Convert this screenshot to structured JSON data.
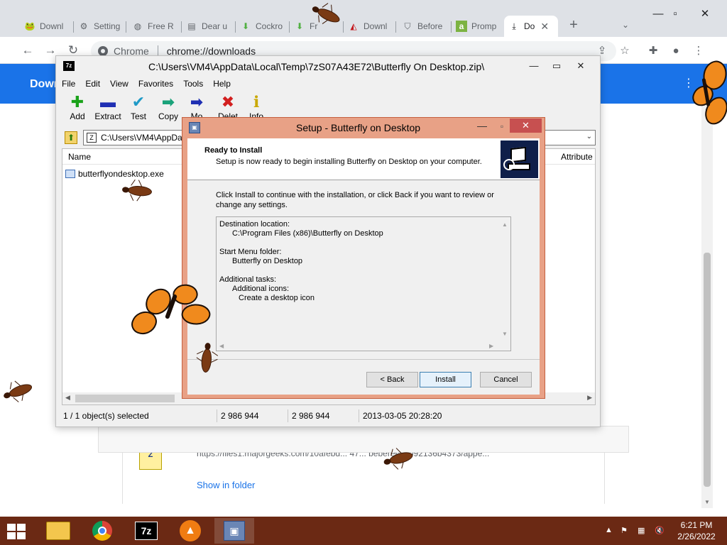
{
  "browser": {
    "tabs": [
      {
        "label": "Downl",
        "icon": "frog-icon"
      },
      {
        "label": "Setting",
        "icon": "gear-icon"
      },
      {
        "label": "Free R",
        "icon": "globe-icon"
      },
      {
        "label": "Dear u",
        "icon": "document-icon"
      },
      {
        "label": "Cockro",
        "icon": "download-arrow-icon"
      },
      {
        "label": "Fr",
        "icon": "download-arrow-icon"
      },
      {
        "label": "Downl",
        "icon": "adobe-icon"
      },
      {
        "label": "Before",
        "icon": "shield-icon"
      },
      {
        "label": "Promp",
        "icon": "a-letter-icon"
      },
      {
        "label": "Do",
        "icon": "download-icon",
        "active": true
      }
    ],
    "omnibox_chip": "Chrome",
    "url": "chrome://downloads"
  },
  "downloads": {
    "header_title": "Downl",
    "file_url": "https://files1.majorgeeks.com/10afebd... 47... bebereec4092136b4373/appe...",
    "show_in_folder": "Show in folder"
  },
  "sevenzip": {
    "title": "C:\\Users\\VM4\\AppData\\Local\\Temp\\7zS07A43E72\\Butterfly On Desktop.zip\\",
    "menu": [
      "File",
      "Edit",
      "View",
      "Favorites",
      "Tools",
      "Help"
    ],
    "tools": [
      {
        "label": "Add",
        "icon": "add-icon",
        "color": "#1aa21a"
      },
      {
        "label": "Extract",
        "icon": "minus-icon",
        "color": "#1f2fb3"
      },
      {
        "label": "Test",
        "icon": "check-icon",
        "color": "#1f9ac7"
      },
      {
        "label": "Copy",
        "icon": "copy-arrow-icon",
        "color": "#1aa27a"
      },
      {
        "label": "Mo",
        "icon": "move-arrow-icon",
        "color": "#1f2fb3"
      },
      {
        "label": "Delet",
        "icon": "delete-x-icon",
        "color": "#d21f1f"
      },
      {
        "label": "Info",
        "icon": "info-icon",
        "color": "#c9a800"
      }
    ],
    "address": "C:\\Users\\VM4\\AppDa",
    "columns": {
      "name": "Name",
      "attributes": "Attribute"
    },
    "file": "butterflyondesktop.exe",
    "status": {
      "selection": "1 / 1 object(s) selected",
      "size": "2 986 944",
      "packed": "2 986 944",
      "modified": "2013-03-05 20:28:20"
    }
  },
  "setup": {
    "title": "Setup - Butterfly on Desktop",
    "heading": "Ready to Install",
    "subheading": "Setup is now ready to begin installing Butterfly on Desktop on your computer.",
    "body": "Click Install to continue with the installation, or click Back if you want to review or change any settings.",
    "memo": {
      "dest_label": "Destination location:",
      "dest_value": "C:\\Program Files (x86)\\Butterfly on Desktop",
      "start_label": "Start Menu folder:",
      "start_value": "Butterfly on Desktop",
      "tasks_label": "Additional tasks:",
      "tasks_sub": "Additional icons:",
      "tasks_item": "Create a desktop icon"
    },
    "buttons": {
      "back": "< Back",
      "install": "Install",
      "cancel": "Cancel"
    }
  },
  "taskbar": {
    "time": "6:21 PM",
    "date": "2/26/2022"
  },
  "colors": {
    "chrome_blue": "#1a73e8",
    "setup_frame": "#e8a186",
    "taskbar": "#6b2914"
  }
}
